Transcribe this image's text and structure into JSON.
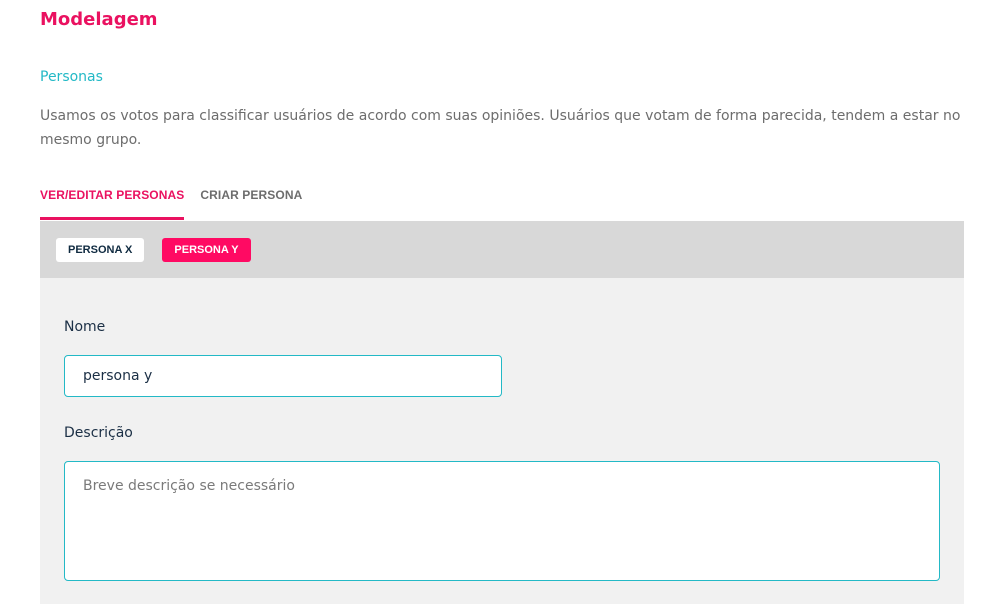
{
  "header": {
    "title": "Modelagem",
    "section_link": "Personas",
    "description": "Usamos os votos para classificar usuários de acordo com suas opiniões. Usuários que votam de forma parecida, tendem a estar no mesmo grupo."
  },
  "tabs": [
    {
      "label": "VER/EDITAR PERSONAS",
      "active": true
    },
    {
      "label": "CRIAR PERSONA",
      "active": false
    }
  ],
  "personas": [
    {
      "label": "PERSONA X",
      "selected": false
    },
    {
      "label": "PERSONA Y",
      "selected": true
    }
  ],
  "form": {
    "name_label": "Nome",
    "name_value": "persona y",
    "description_label": "Descrição",
    "description_placeholder": "Breve descrição se necessário"
  },
  "colors": {
    "accent": "#ea1160",
    "link": "#23b9c6",
    "chip_selected": "#ff0a63",
    "panel_bg": "#f1f1f1",
    "bar_bg": "#d8d8d8"
  }
}
